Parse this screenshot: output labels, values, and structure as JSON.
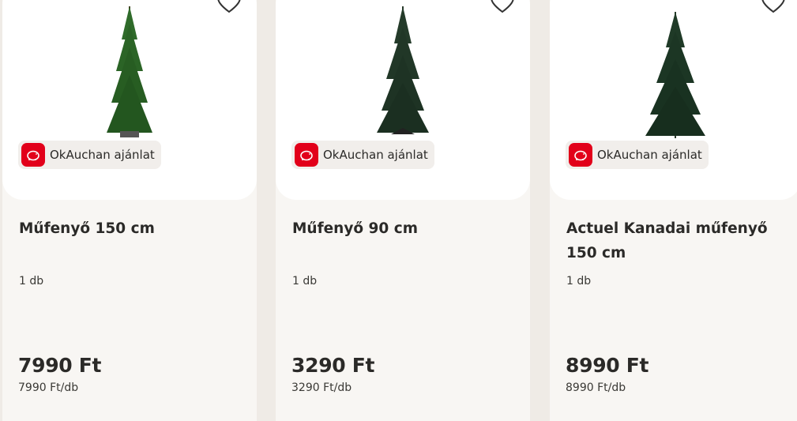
{
  "colors": {
    "background": "#efebe6",
    "card": "#f8f6f3",
    "badge_red": "#e2001a"
  },
  "products": [
    {
      "title": "Műfenyő 150 cm",
      "badge": "OkAuchan ajánlat",
      "quantity": "1 db",
      "price": "7990 Ft",
      "unit_price": "7990 Ft/db",
      "image_icon": "christmas-tree-icon"
    },
    {
      "title": "Műfenyő 90 cm",
      "badge": "OkAuchan ajánlat",
      "quantity": "1 db",
      "price": "3290 Ft",
      "unit_price": "3290 Ft/db",
      "image_icon": "christmas-tree-icon"
    },
    {
      "title": "Actuel Kanadai műfenyő 150 cm",
      "badge": "OkAuchan ajánlat",
      "quantity": "1 db",
      "price": "8990 Ft",
      "unit_price": "8990 Ft/db",
      "image_icon": "christmas-tree-icon"
    }
  ]
}
